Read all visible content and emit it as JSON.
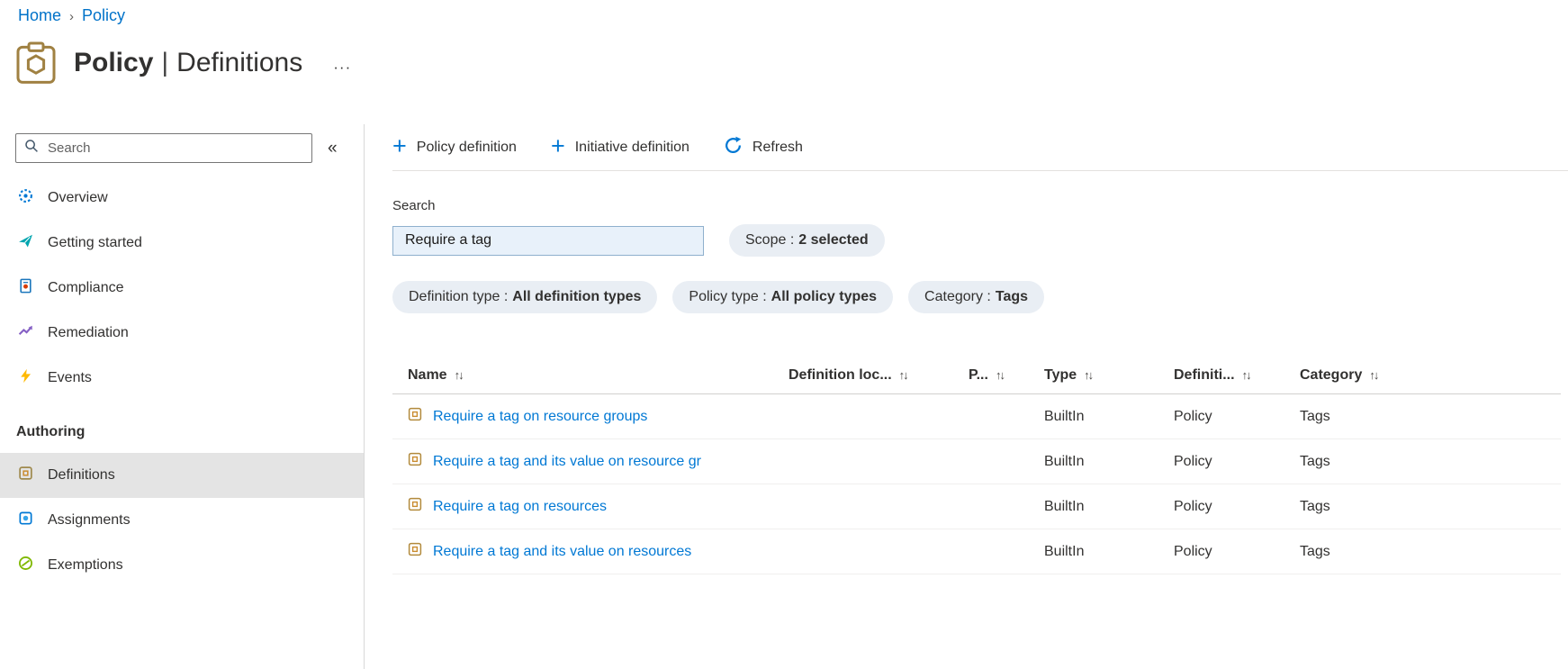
{
  "icons": {
    "plus": "+",
    "sort": "↑↓",
    "breadcrumb_chevron": "›",
    "collapse": "«",
    "more": "···"
  },
  "breadcrumb": {
    "items": [
      {
        "label": "Home"
      },
      {
        "label": "Policy"
      }
    ]
  },
  "header": {
    "title": "Policy",
    "separator": "|",
    "subtitle": "Definitions"
  },
  "sidebar": {
    "search_placeholder": "Search",
    "items": [
      {
        "label": "Overview"
      },
      {
        "label": "Getting started"
      },
      {
        "label": "Compliance"
      },
      {
        "label": "Remediation"
      },
      {
        "label": "Events"
      }
    ],
    "section_label": "Authoring",
    "authoring_items": [
      {
        "label": "Definitions"
      },
      {
        "label": "Assignments"
      },
      {
        "label": "Exemptions"
      }
    ]
  },
  "toolbar": {
    "policy_definition": "Policy definition",
    "initiative_definition": "Initiative definition",
    "refresh": "Refresh"
  },
  "filters": {
    "search_label": "Search",
    "search_value": "Require a tag",
    "scope_pill": {
      "label": "Scope :",
      "value": "2 selected"
    },
    "pills": [
      {
        "label": "Definition type :",
        "value": "All definition types"
      },
      {
        "label": "Policy type :",
        "value": "All policy types"
      },
      {
        "label": "Category :",
        "value": "Tags"
      }
    ]
  },
  "table": {
    "columns": [
      {
        "label": "Name"
      },
      {
        "label": "Definition loc..."
      },
      {
        "label": "P..."
      },
      {
        "label": "Type"
      },
      {
        "label": "Definiti..."
      },
      {
        "label": "Category"
      }
    ],
    "rows": [
      {
        "name": "Require a tag on resource groups",
        "type": "BuiltIn",
        "definition_type": "Policy",
        "category": "Tags"
      },
      {
        "name": "Require a tag and its value on resource gr",
        "type": "BuiltIn",
        "definition_type": "Policy",
        "category": "Tags"
      },
      {
        "name": "Require a tag on resources",
        "type": "BuiltIn",
        "definition_type": "Policy",
        "category": "Tags"
      },
      {
        "name": "Require a tag and its value on resources",
        "type": "BuiltIn",
        "definition_type": "Policy",
        "category": "Tags"
      }
    ]
  },
  "colors": {
    "accent": "#0078d4",
    "link": "#0078d4",
    "pill_background": "#e9eef4",
    "selected_item_background": "#e4e4e4"
  }
}
